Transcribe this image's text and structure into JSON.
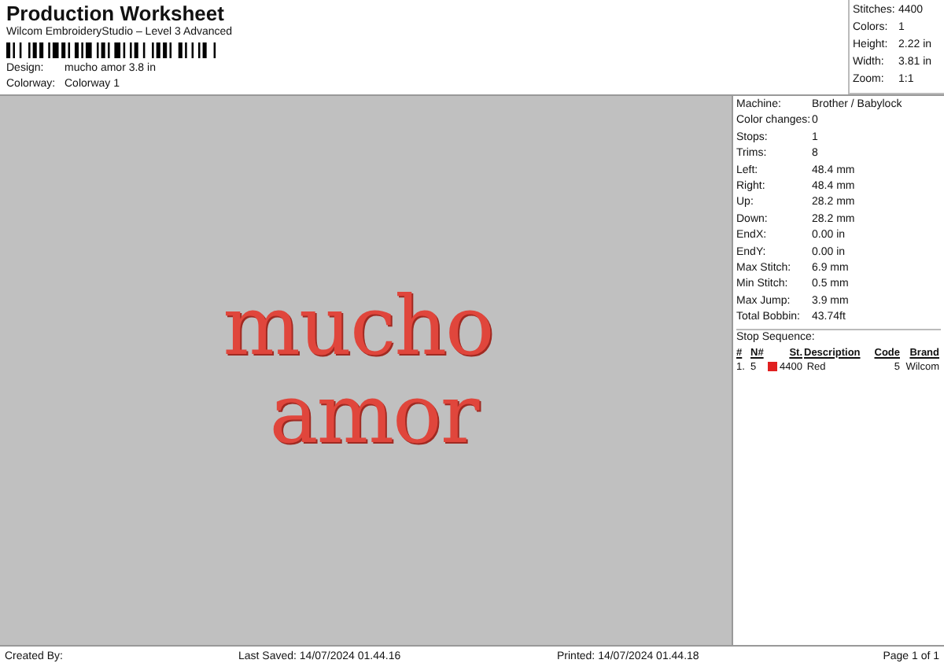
{
  "header": {
    "title": "Production Worksheet",
    "subtitle": "Wilcom EmbroideryStudio – Level 3 Advanced",
    "fields": [
      {
        "label": "Design:",
        "value": "mucho amor 3.8 in"
      },
      {
        "label": "Colorway:",
        "value": "Colorway 1"
      }
    ]
  },
  "summary": [
    {
      "label": "Stitches:",
      "value": "4400"
    },
    {
      "label": "Colors:",
      "value": "1"
    },
    {
      "label": "Height:",
      "value": "2.22 in"
    },
    {
      "label": "Width:",
      "value": "3.81 in"
    },
    {
      "label": "Zoom:",
      "value": "1:1"
    }
  ],
  "design_preview": {
    "lines": [
      "mucho",
      "amor"
    ]
  },
  "details": [
    {
      "label": "Machine:",
      "value": "Brother / Babylock"
    },
    {
      "label": "Color changes:",
      "value": "0"
    },
    {
      "label": "Stops:",
      "value": "1"
    },
    {
      "label": "Trims:",
      "value": "8"
    },
    {
      "label": "Left:",
      "value": "48.4 mm"
    },
    {
      "label": "Right:",
      "value": "48.4 mm"
    },
    {
      "label": "Up:",
      "value": "28.2 mm"
    },
    {
      "label": "Down:",
      "value": "28.2 mm"
    },
    {
      "label": "EndX:",
      "value": "0.00 in"
    },
    {
      "label": "EndY:",
      "value": "0.00 in"
    },
    {
      "label": "Max Stitch:",
      "value": "6.9 mm"
    },
    {
      "label": "Min Stitch:",
      "value": "0.5 mm"
    },
    {
      "label": "Max Jump:",
      "value": "3.9 mm"
    },
    {
      "label": "Total Bobbin:",
      "value": "43.74ft"
    }
  ],
  "stop_sequence": {
    "title": "Stop Sequence:",
    "columns": [
      "#",
      "N#",
      "St.",
      "Description",
      "Code",
      "Brand"
    ],
    "rows": [
      {
        "index": "1.",
        "needle": "5",
        "color": "#e02020",
        "stitches": "4400",
        "description": "Red",
        "code": "5",
        "brand": "Wilcom"
      }
    ]
  },
  "footer": {
    "created_by": "Created By:",
    "last_saved": "Last Saved: 14/07/2024 01.44.16",
    "printed": "Printed: 14/07/2024 01.44.18",
    "page": "Page 1 of 1"
  }
}
